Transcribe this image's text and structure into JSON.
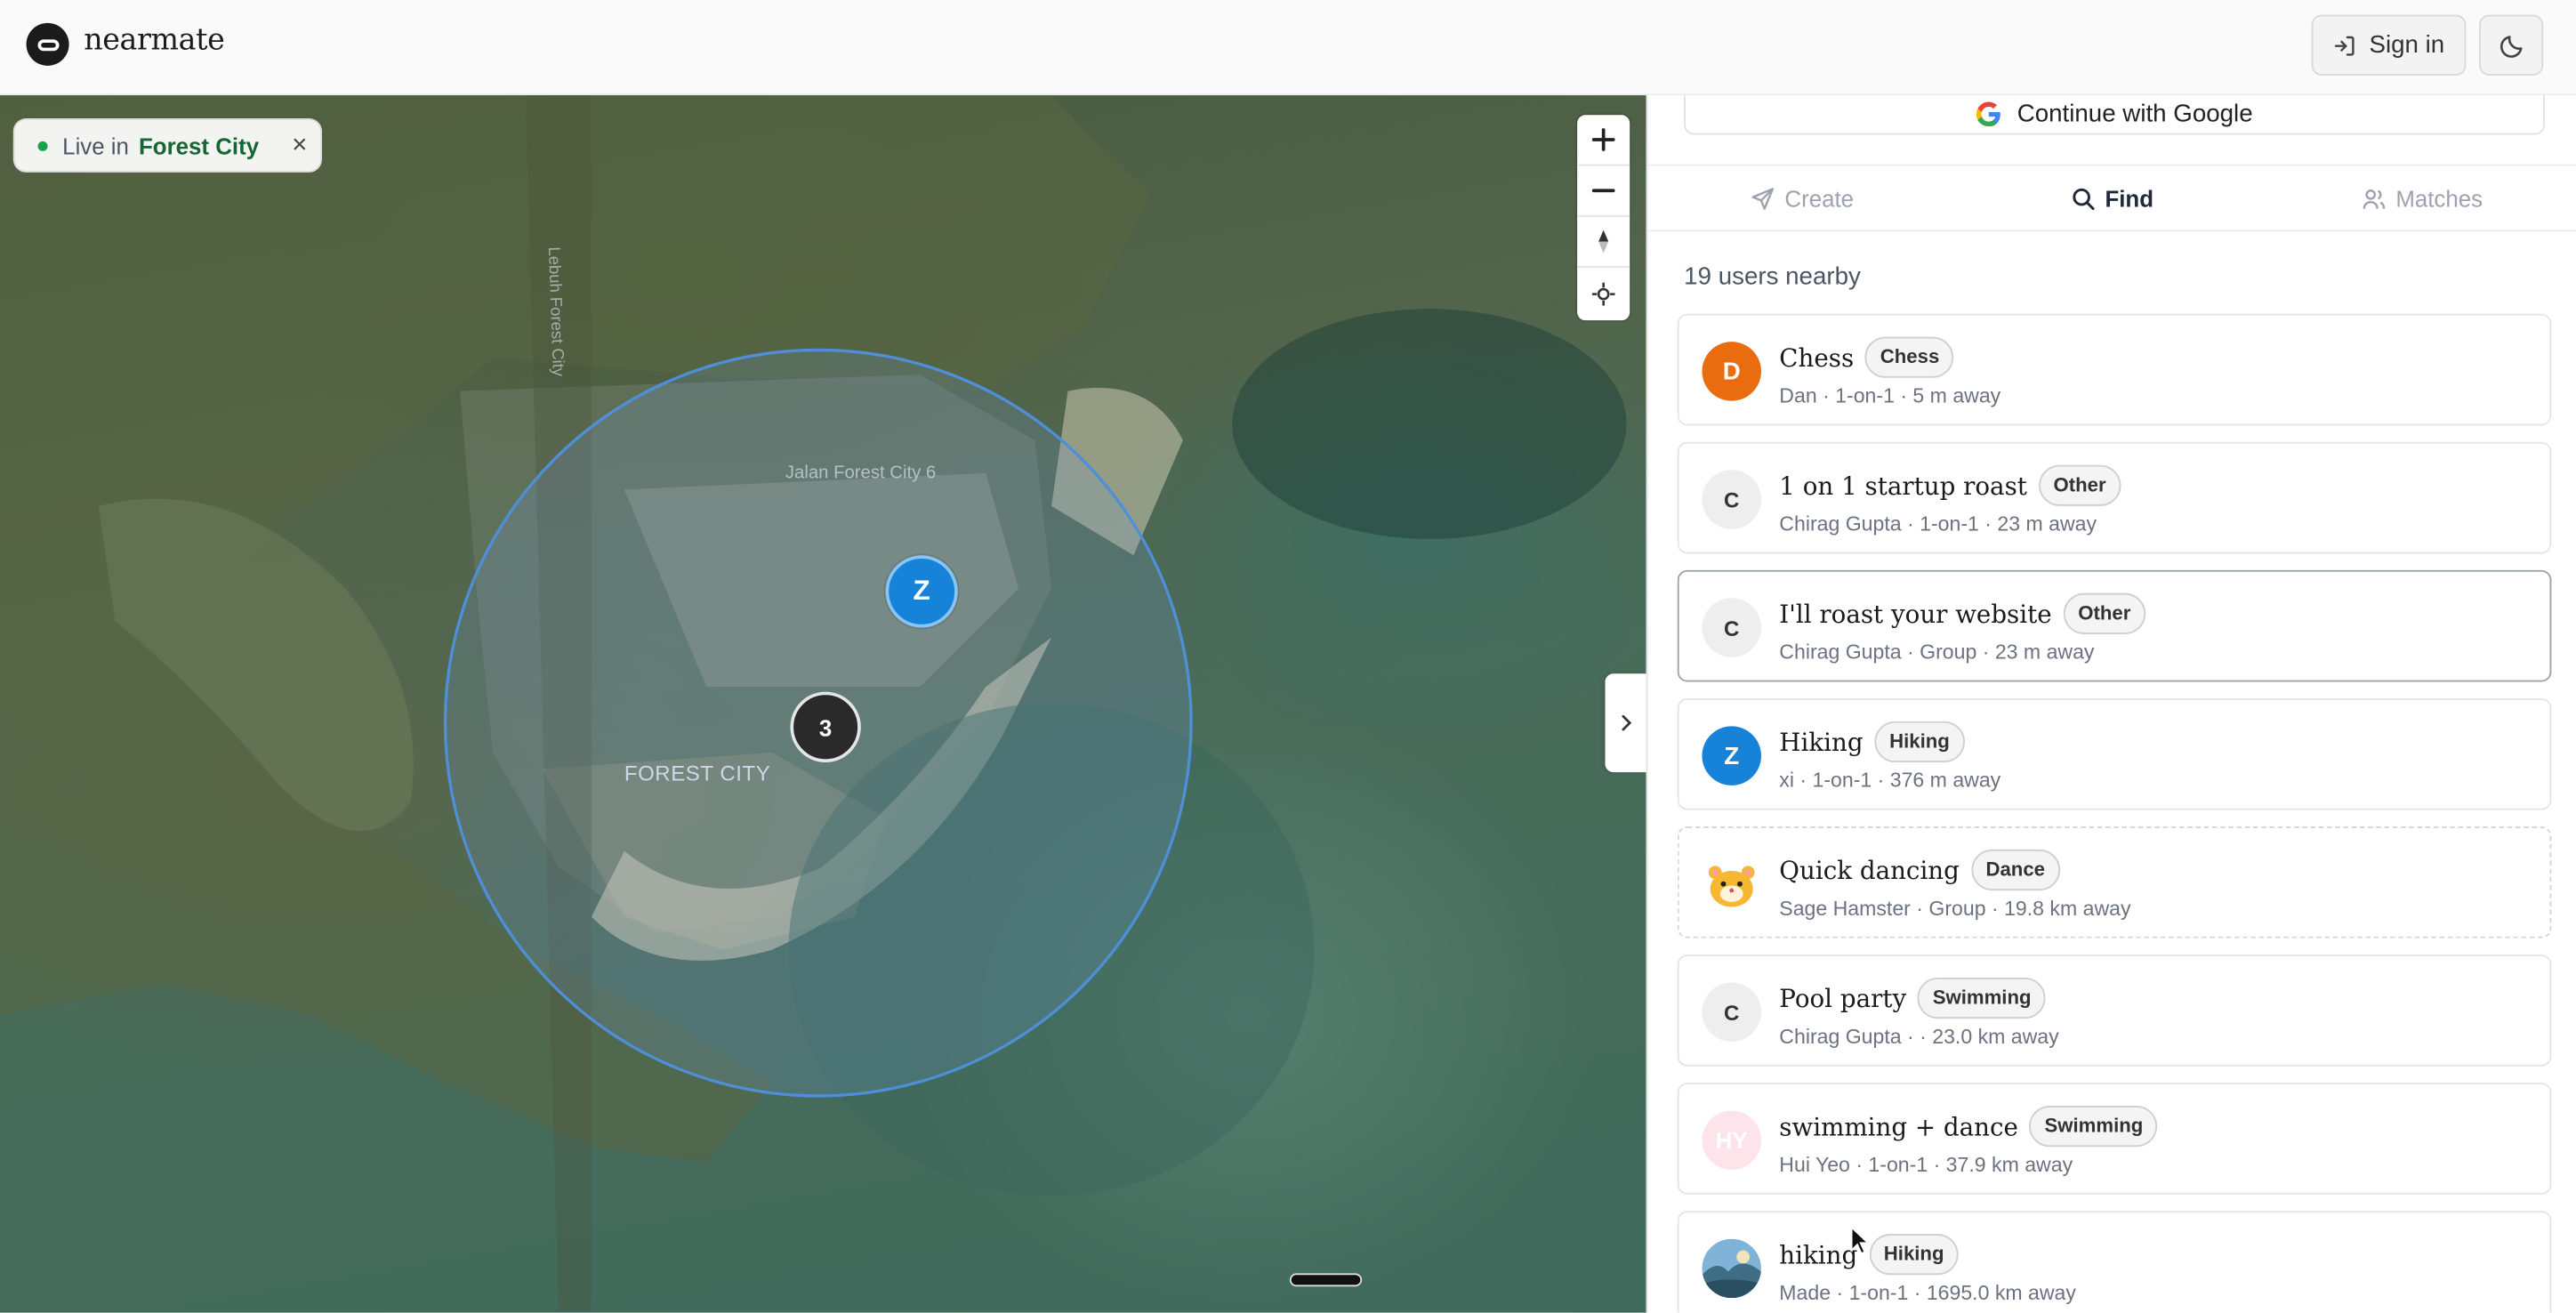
{
  "app": {
    "name": "nearmate"
  },
  "header": {
    "signin_label": "Sign in"
  },
  "map": {
    "live_prefix": "Live in",
    "live_city": "Forest City",
    "labels": {
      "city": "FOREST CITY",
      "road": "Jalan Forest City 6",
      "road2": "Lebuh Forest City"
    },
    "markers": {
      "user_initial": "Z",
      "cluster_count": "3"
    }
  },
  "panel": {
    "google_label": "Continue with Google",
    "tabs": [
      {
        "label": "Create",
        "icon": "send-icon"
      },
      {
        "label": "Find",
        "icon": "search-icon"
      },
      {
        "label": "Matches",
        "icon": "users-icon"
      }
    ],
    "users_nearby": "19 users nearby",
    "cards": [
      {
        "avatar": "D",
        "title": "Chess",
        "tag": "Chess",
        "sub": "Dan · 1-on-1 · 5 m away"
      },
      {
        "avatar": "C",
        "title": "1 on 1 startup roast",
        "tag": "Other",
        "sub": "Chirag Gupta · 1-on-1 · 23 m away"
      },
      {
        "avatar": "C",
        "title": "I'll roast your website",
        "tag": "Other",
        "sub": "Chirag Gupta · Group · 23 m away"
      },
      {
        "avatar": "Z",
        "title": "Hiking",
        "tag": "Hiking",
        "sub": "xi · 1-on-1 · 376 m away"
      },
      {
        "avatar": "",
        "title": "Quick dancing",
        "tag": "Dance",
        "sub": "Sage Hamster · Group · 19.8 km away"
      },
      {
        "avatar": "C",
        "title": "Pool party",
        "tag": "Swimming",
        "sub": "Chirag Gupta · · 23.0 km away"
      },
      {
        "avatar": "HY",
        "title": "swimming + dance",
        "tag": "Swimming",
        "sub": "Hui Yeo · 1-on-1 · 37.9 km away"
      },
      {
        "avatar": "",
        "title": "hiking",
        "tag": "Hiking",
        "sub": "Made · 1-on-1 · 1695.0 km away"
      }
    ]
  },
  "colors": {
    "accent": "#1683d8",
    "live": "#16a34a",
    "avatar_orange": "#ea6c10"
  }
}
